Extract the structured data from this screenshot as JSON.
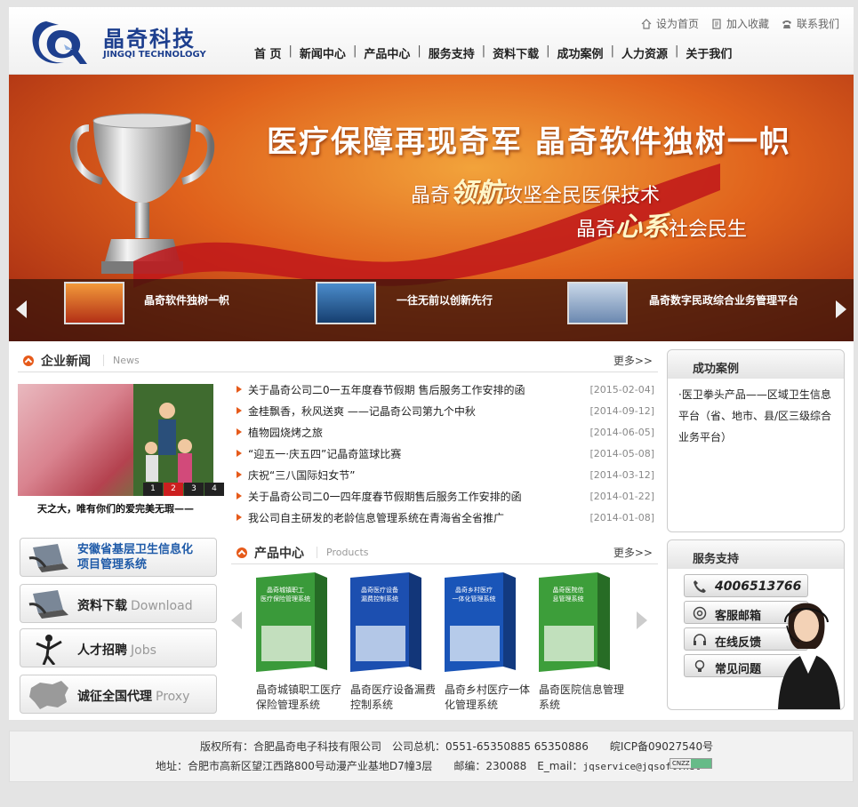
{
  "logo": {
    "cn": "晶奇科技",
    "en": "JINGQI TECHNOLOGY"
  },
  "toplinks": [
    "设为首页",
    "加入收藏",
    "联系我们"
  ],
  "nav": [
    "首 页",
    "新闻中心",
    "产品中心",
    "服务支持",
    "资料下载",
    "成功案例",
    "人力资源",
    "关于我们"
  ],
  "banner": {
    "title": "医疗保障再现奇军 晶奇软件独树一帜",
    "line1_pre": "晶奇",
    "line1_em": "领航",
    "line1_post": "攻坚全民医保技术",
    "line2_pre": "晶奇",
    "line2_em": "心系",
    "line2_post": "社会民生",
    "thumbs": [
      "晶奇软件独树一帜",
      "一往无前以创新先行",
      "晶奇数字民政综合业务管理平台"
    ]
  },
  "news": {
    "title": "企业新闻",
    "en": "News",
    "more": "更多>>",
    "caption": "天之大，唯有你们的爱完美无瑕——",
    "pager": [
      "1",
      "2",
      "3",
      "4"
    ],
    "items": [
      {
        "title": "关于晶奇公司二0一五年度春节假期 售后服务工作安排的函",
        "date": "[2015-02-04]"
      },
      {
        "title": "金桂飘香，秋风送爽 ——记晶奇公司第九个中秋",
        "date": "[2014-09-12]"
      },
      {
        "title": "植物园烧烤之旅",
        "date": "[2014-06-05]"
      },
      {
        "title": "“迎五一·庆五四”记晶奇篮球比赛",
        "date": "[2014-05-08]"
      },
      {
        "title": "庆祝“三八国际妇女节”",
        "date": "[2014-03-12]"
      },
      {
        "title": "关于晶奇公司二0一四年度春节假期售后服务工作安排的函",
        "date": "[2014-01-22]"
      },
      {
        "title": "我公司自主研发的老龄信息管理系统在青海省全省推广",
        "date": "[2014-01-08]"
      }
    ]
  },
  "left_buttons": {
    "project": {
      "line1": "安徽省基层卫生信息化",
      "line2": "项目管理系统"
    },
    "download": {
      "cn": "资料下载",
      "en": "Download"
    },
    "jobs": {
      "cn": "人才招聘",
      "en": "Jobs"
    },
    "proxy": {
      "cn": "诚征全国代理",
      "en": "Proxy"
    }
  },
  "products": {
    "title": "产品中心",
    "en": "Products",
    "more": "更多>>",
    "items": [
      {
        "box": "晶奇城镇职工医疗保险管理系统",
        "name": "晶奇城镇职工医疗保险管理系统",
        "color": "#3a9a3a"
      },
      {
        "box": "晶奇医疗设备漏费控制系统",
        "name": "晶奇医疗设备漏费控制系统",
        "color": "#1c4fb0"
      },
      {
        "box": "晶奇乡村医疗一体化管理系统",
        "name": "晶奇乡村医疗一体化管理系统",
        "color": "#1a55b8"
      },
      {
        "box": "晶奇医院信息管理系统",
        "name": "晶奇医院信息管理系统",
        "color": "#3d9e3a"
      }
    ]
  },
  "cases": {
    "title": "成功案例",
    "text": "·医卫拳头产品——区域卫生信息平台（省、地市、县/区三级综合业务平台）"
  },
  "service": {
    "title": "服务支持",
    "phone": "4006513766",
    "mail": "客服邮箱",
    "feedback": "在线反馈",
    "faq": "常见问题"
  },
  "footer": {
    "line1": "版权所有：合肥晶奇电子科技有限公司　公司总机：0551-65350885 65350886　　皖ICP备09027540号",
    "line2_pre": "地址：合肥市高新区望江西路800号动漫产业基地D7幢3层　　邮编：230088　E_mail：",
    "email": "jqservice@jqsoft.net",
    "cnzz": "CNZZ"
  },
  "colors": {
    "accent": "#e65a1a",
    "brand": "#1d3f8e"
  }
}
